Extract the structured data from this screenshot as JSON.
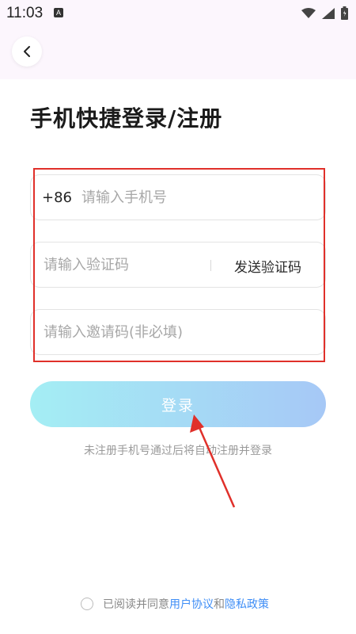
{
  "status_bar": {
    "time": "11:03",
    "notification_icon": "a-letter-icon",
    "wifi_icon": "wifi-icon",
    "signal_icon": "signal-icon",
    "battery_icon": "battery-icon"
  },
  "header": {
    "back_icon": "chevron-left-icon"
  },
  "page": {
    "title": "手机快捷登录/注册"
  },
  "form": {
    "country_code": "+86",
    "phone_placeholder": "请输入手机号",
    "code_placeholder": "请输入验证码",
    "send_code_label": "发送验证码",
    "invite_placeholder": "请输入邀请码(非必填)"
  },
  "login_button": {
    "label": "登录",
    "gradient_start": "#a4eef4",
    "gradient_end": "#a6c8f6"
  },
  "hint": "未注册手机号通过后将自动注册并登录",
  "agreement": {
    "prefix": "已阅读并同意",
    "user_agreement": "用户协议",
    "and": "和",
    "privacy_policy": "隐私政策",
    "link_color": "#3f8ef6"
  },
  "annotation_color": "#e0302a"
}
